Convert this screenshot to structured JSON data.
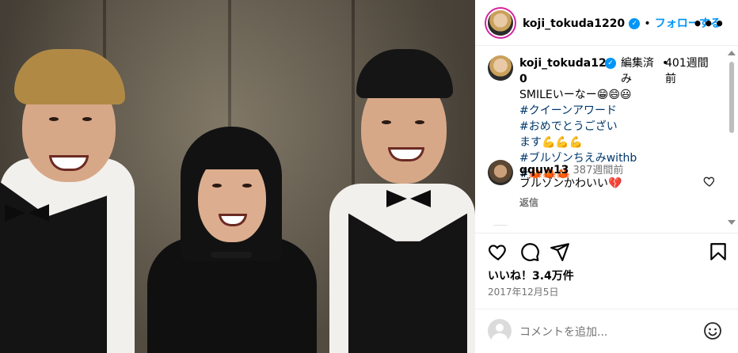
{
  "header": {
    "username": "koji_tokuda1220",
    "verified_mark": "✓",
    "separator": "•",
    "follow_label": "フォローする",
    "more_label": "•••"
  },
  "caption": {
    "username_line1": "koji_tokuda122",
    "username_line2": "0",
    "edited_label_1": "編集済",
    "edited_label_2": "み",
    "dot": "•",
    "time_1": "401週間",
    "time_2": "前",
    "text": "SMILEいーなー😁😄😃",
    "hashtags": [
      "#クイーンアワード",
      "#おめでとうござい",
      "ます💪💪💪",
      "#ブルゾンちえみwithb",
      "#🦀🦀🦀"
    ]
  },
  "comments": [
    {
      "username": "gquw13",
      "time": "387週間前",
      "text": "ブルゾンかわいい💔",
      "reply_label": "返信"
    }
  ],
  "actions": {
    "like_icon": "heart-icon",
    "comment_icon": "comment-icon",
    "share_icon": "share-icon",
    "save_icon": "bookmark-icon"
  },
  "likes_label": "いいね！3.4万件",
  "date_label": "2017年12月5日",
  "comment_placeholder": "コメントを追加...",
  "colors": {
    "accent": "#0095f6",
    "hashtag": "#00376b",
    "muted": "#737373"
  }
}
